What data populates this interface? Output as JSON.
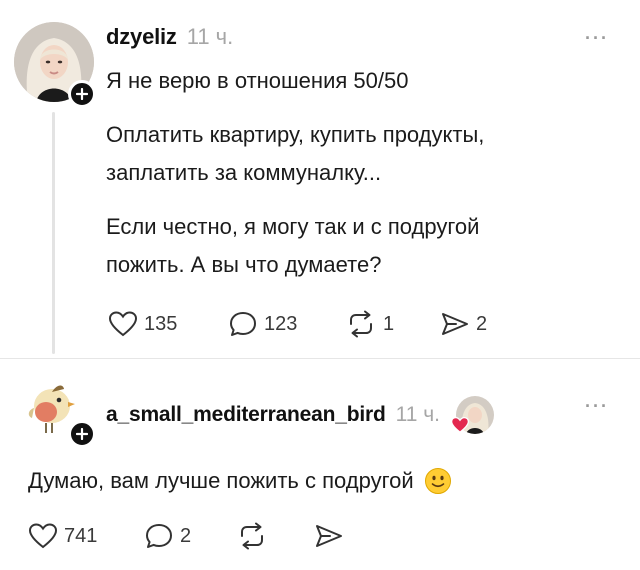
{
  "post": {
    "username": "dzyeliz",
    "time": "11 ч.",
    "more_label": "···",
    "lines": [
      "Я не верю в отношения 50/50",
      "Оплатить квартиру, купить продукты,",
      "заплатить за коммуналку...",
      "Если честно, я могу так и с подругой",
      "пожить. А вы что думаете?"
    ],
    "likes": "135",
    "comments": "123",
    "reposts": "1",
    "shares": "2"
  },
  "reply": {
    "username": "a_small_mediterranean_bird",
    "time": "11 ч.",
    "more_label": "···",
    "text": "Думаю, вам лучше пожить с подругой",
    "likes": "741",
    "comments": "2"
  },
  "icons": {
    "like": "heart-icon",
    "comment": "comment-bubble-icon",
    "repost": "repost-icon",
    "share": "send-icon",
    "follow": "plus-icon",
    "emoji": "slightly-smiling-face"
  },
  "colors": {
    "text": "#111111",
    "muted": "#a6a6a6",
    "heart": "#e3284f",
    "emoji": "#ffcc33"
  }
}
